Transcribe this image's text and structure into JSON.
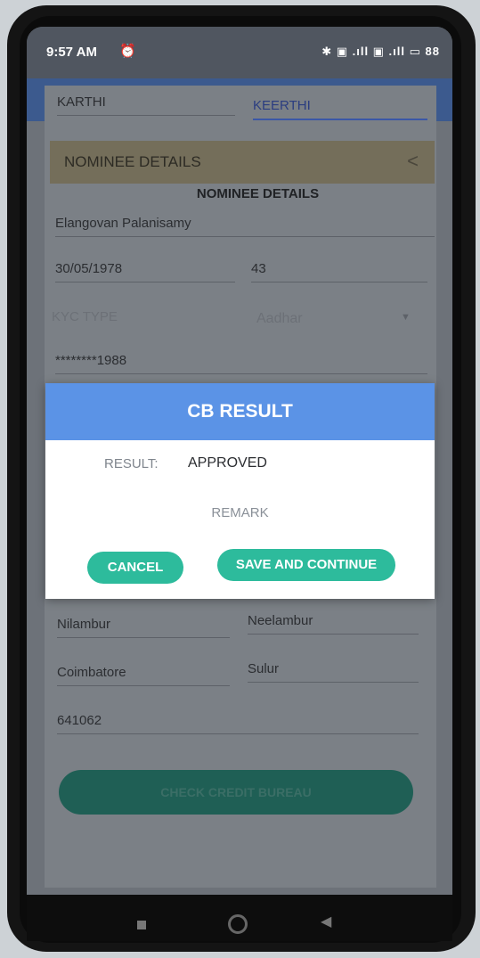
{
  "status_bar": {
    "time": "9:57 AM",
    "alarm_icon": "alarm-clock-icon",
    "icons": "✱ ▣ .ıll ▣ .ıll ▭",
    "battery": "88"
  },
  "header_fields": {
    "first": "KARTHI",
    "second": "KEERTHI"
  },
  "section": {
    "title": "NOMINEE DETAILS",
    "chevron": "<"
  },
  "nominee": {
    "heading": "NOMINEE DETAILS",
    "name": "Elangovan Palanisamy",
    "dob": "30/05/1978",
    "age": "43",
    "kyc_type_label": "KYC TYPE",
    "kyc_type_value": "Aadhar",
    "kyc_number": "********1988"
  },
  "address": {
    "place1": "Nilambur",
    "place2": "Neelambur",
    "city": "Coimbatore",
    "taluk": "Sulur",
    "pincode": "641062"
  },
  "check_button": "CHECK CREDIT BUREAU",
  "dialog": {
    "title": "CB RESULT",
    "result_label": "RESULT:",
    "result_value": "APPROVED",
    "remark_label": "REMARK",
    "cancel_label": "CANCEL",
    "save_label": "SAVE AND CONTINUE"
  },
  "colors": {
    "dialog_header": "#5b93e6",
    "button_teal": "#2dbb9c",
    "active_underline": "#3b57a6"
  }
}
